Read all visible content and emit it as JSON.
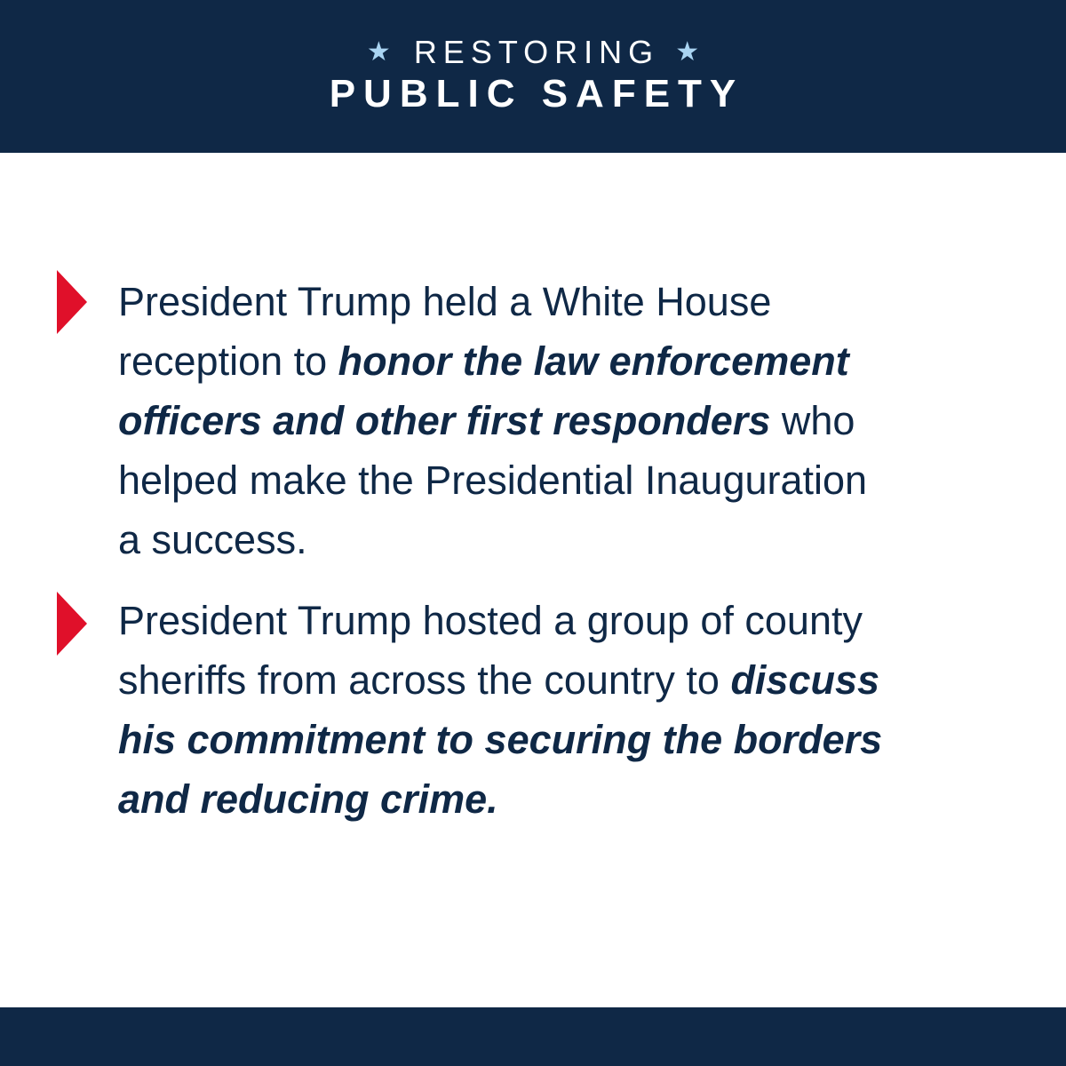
{
  "colors": {
    "navy": "#0f2846",
    "red_bullet": "#e0102a",
    "star_blue": "#a9d4f2",
    "background": "#ffffff"
  },
  "header": {
    "star_left": "★",
    "kicker": "RESTORING",
    "star_right": "★",
    "title": "PUBLIC SAFETY"
  },
  "items": [
    {
      "bullet_icon": "red-triangle-right",
      "line1": "President Trump held a White House",
      "line2_plain": "reception to ",
      "line2_bold": "honor the law enforcement",
      "line3_bold": "officers and other first responders",
      "line3_plain": " who",
      "line4": "helped make the Presidential Inauguration",
      "line5": "a success."
    },
    {
      "bullet_icon": "red-triangle-right",
      "line1": "President Trump hosted a group of county",
      "line2_plain": "sheriffs from across the country to ",
      "line2_bold": "discuss",
      "line3_bold": "his commitment to securing the borders",
      "line4_bold": "and reducing crime."
    }
  ]
}
